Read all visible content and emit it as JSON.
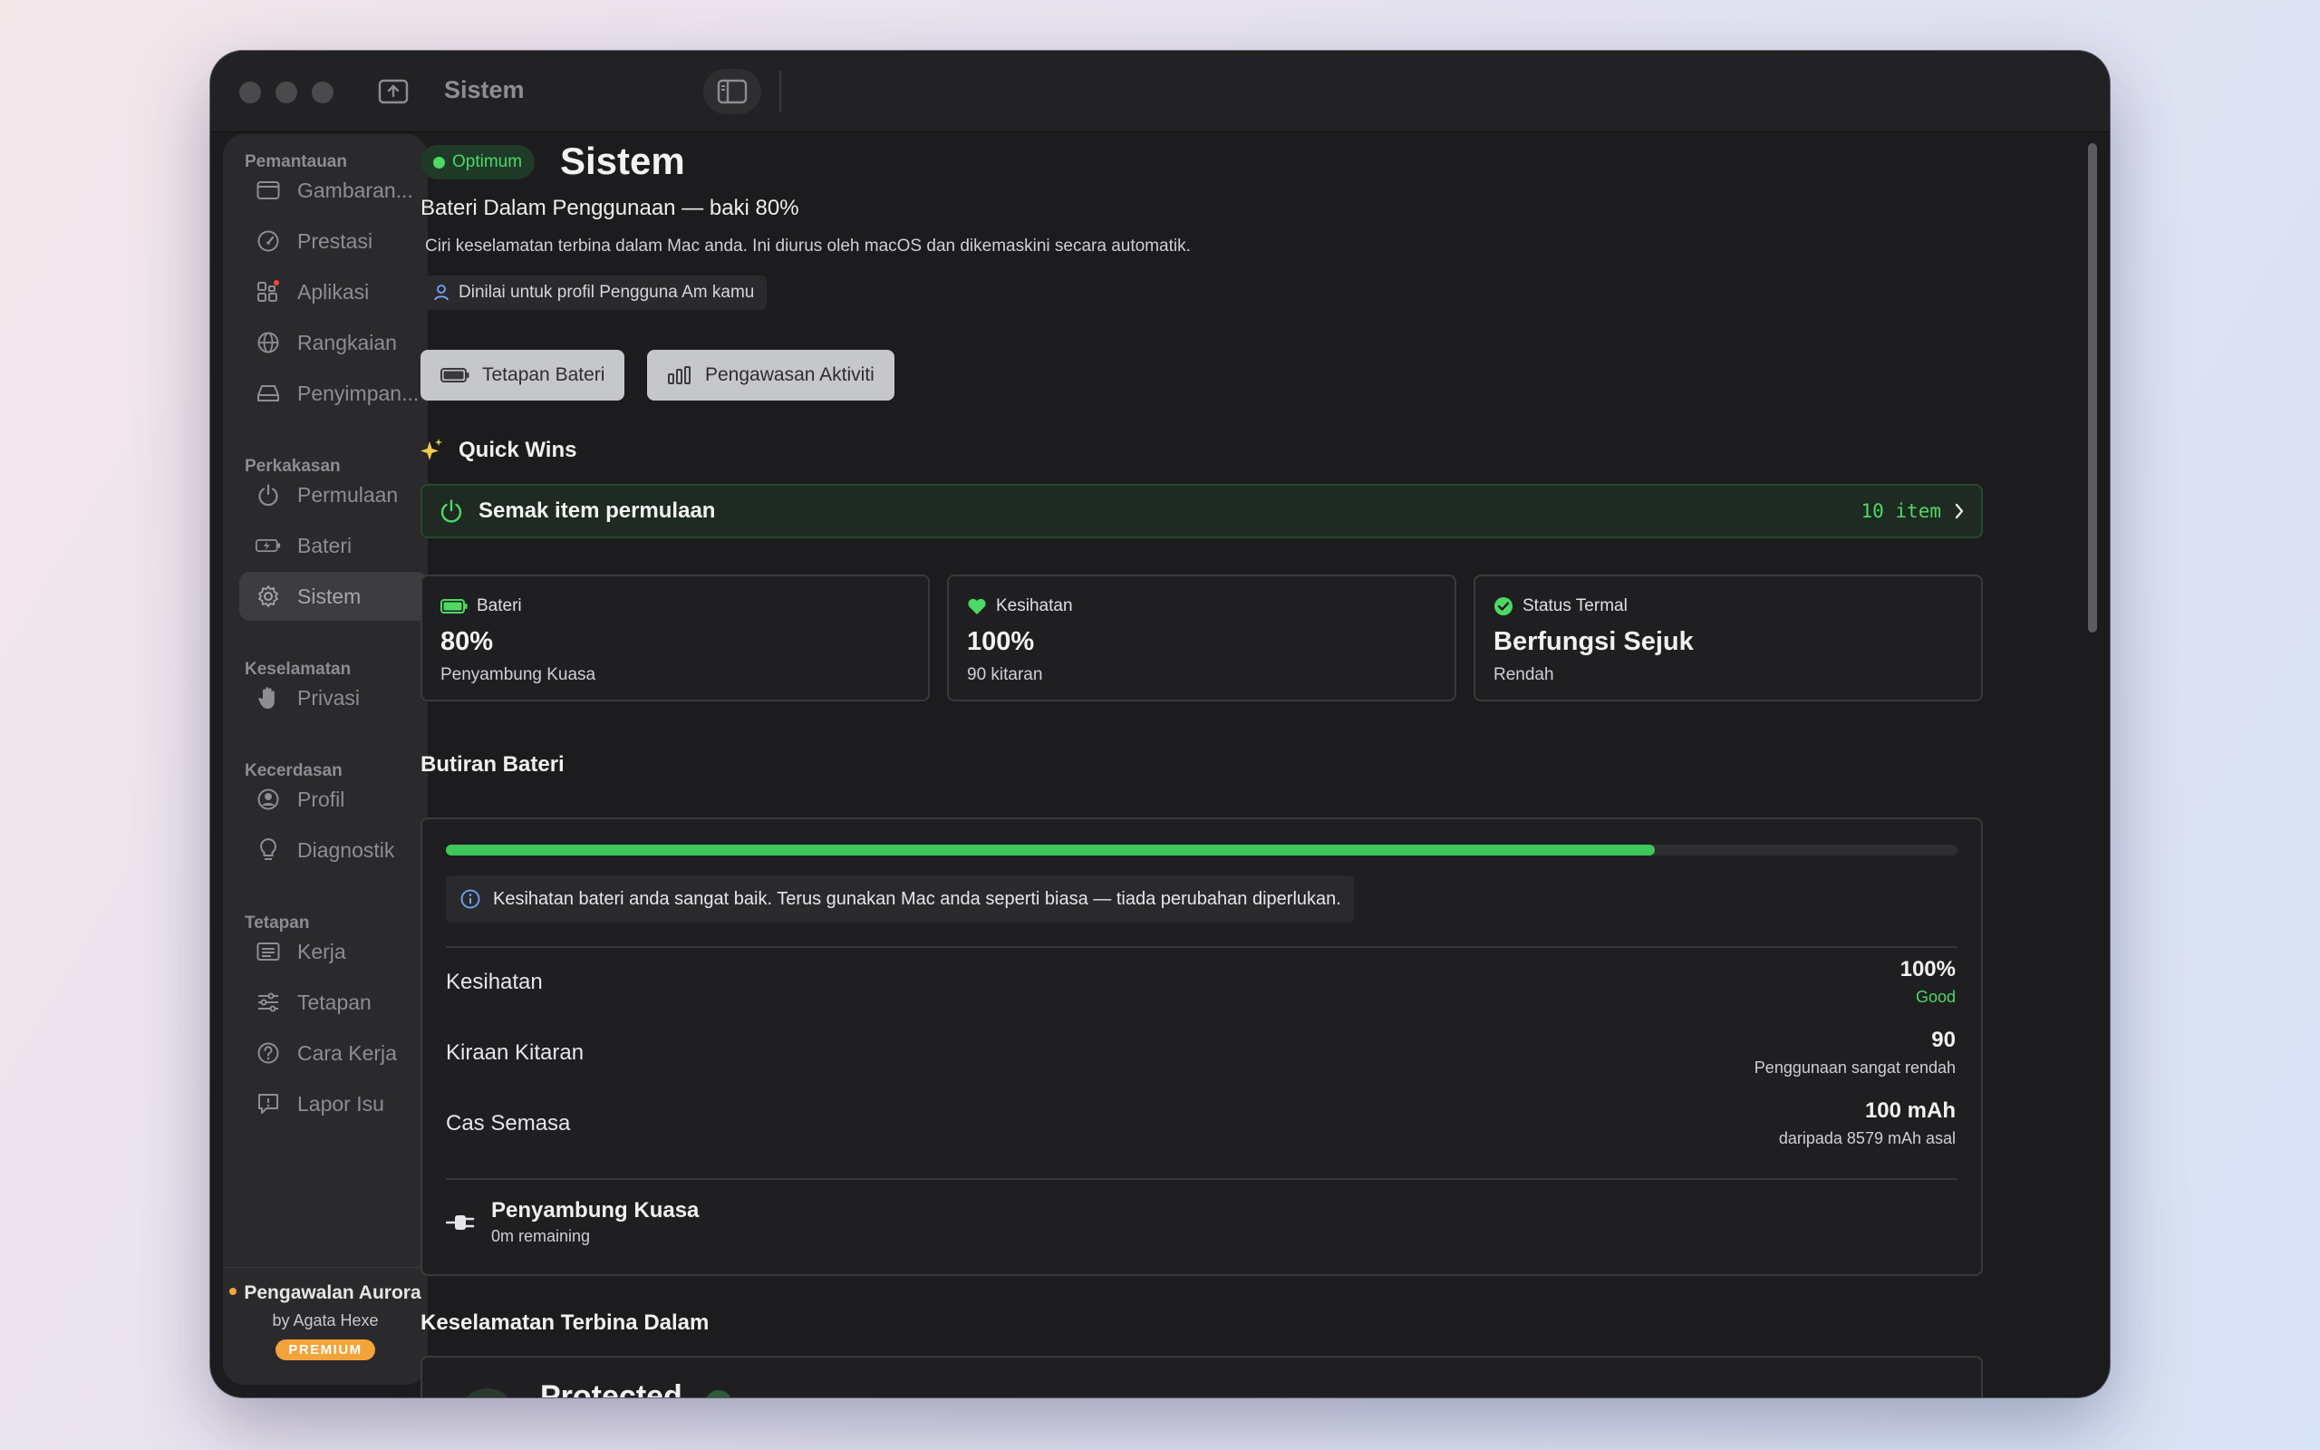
{
  "window": {
    "title": "Sistem"
  },
  "sidebar": {
    "sections": [
      {
        "title": "Pemantauan",
        "items": [
          {
            "label": "Gambaran...",
            "icon": "window-icon"
          },
          {
            "label": "Prestasi",
            "icon": "gauge-icon"
          },
          {
            "label": "Aplikasi",
            "icon": "apps-grid-icon"
          },
          {
            "label": "Rangkaian",
            "icon": "globe-icon"
          },
          {
            "label": "Penyimpan...",
            "icon": "drive-icon"
          }
        ]
      },
      {
        "title": "Perkakasan",
        "items": [
          {
            "label": "Permulaan",
            "icon": "power-icon"
          },
          {
            "label": "Bateri",
            "icon": "battery-charging-icon"
          },
          {
            "label": "Sistem",
            "icon": "gear-icon"
          }
        ]
      },
      {
        "title": "Keselamatan",
        "items": [
          {
            "label": "Privasi",
            "icon": "hand-icon"
          }
        ]
      },
      {
        "title": "Kecerdasan",
        "items": [
          {
            "label": "Profil",
            "icon": "person-circle-icon"
          },
          {
            "label": "Diagnostik",
            "icon": "lightbulb-icon"
          }
        ]
      },
      {
        "title": "Tetapan",
        "items": [
          {
            "label": "Kerja",
            "icon": "list-icon"
          },
          {
            "label": "Tetapan",
            "icon": "sliders-icon"
          },
          {
            "label": "Cara Kerja",
            "icon": "question-icon"
          },
          {
            "label": "Lapor Isu",
            "icon": "report-icon"
          }
        ]
      }
    ],
    "footer": {
      "name": "Pengawalan Aurora",
      "by": "by Agata Hexe",
      "badge": "PREMIUM"
    }
  },
  "header": {
    "status_pill": "Optimum",
    "title": "Sistem",
    "subtitle": "Bateri Dalam Penggunaan — baki 80%",
    "description": "Ciri keselamatan terbina dalam Mac anda. Ini diurus oleh macOS dan dikemaskini secara automatik.",
    "profile_chip": "Dinilai untuk profil Pengguna Am kamu"
  },
  "actions": {
    "battery_settings": "Tetapan Bateri",
    "activity_monitor": "Pengawasan Aktiviti"
  },
  "quick_wins": {
    "title": "Quick Wins",
    "row_label": "Semak item permulaan",
    "row_count": "10 item"
  },
  "cards": [
    {
      "head": "Bateri",
      "value": "80%",
      "sub": "Penyambung Kuasa"
    },
    {
      "head": "Kesihatan",
      "value": "100%",
      "sub": "90 kitaran"
    },
    {
      "head": "Status Termal",
      "value": "Berfungsi Sejuk",
      "sub": "Rendah"
    }
  ],
  "battery_details": {
    "title": "Butiran Bateri",
    "charge_fraction": 0.8,
    "info": "Kesihatan bateri anda sangat baik. Terus gunakan Mac anda seperti biasa — tiada perubahan diperlukan.",
    "rows": [
      {
        "label": "Kesihatan",
        "value": "100%",
        "note": "Good"
      },
      {
        "label": "Kiraan Kitaran",
        "value": "90",
        "note": "Penggunaan sangat rendah"
      },
      {
        "label": "Cas Semasa",
        "value": "100 mAh",
        "note": "daripada  8579 mAh asal"
      }
    ],
    "power": {
      "title": "Penyambung Kuasa",
      "sub": "0m remaining"
    }
  },
  "builtin_security": {
    "title": "Keselamatan Terbina Dalam",
    "status": "Protected"
  },
  "colors": {
    "accent_green": "#4cd964",
    "premium": "#f2a43a",
    "background": "#1c1c1e"
  }
}
